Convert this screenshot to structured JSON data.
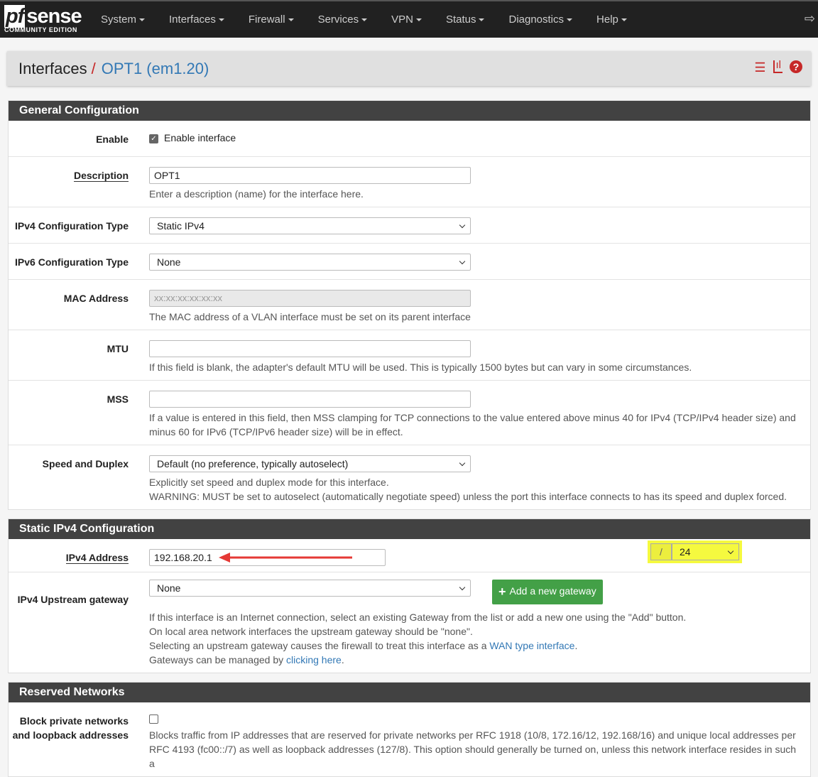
{
  "nav": {
    "logo": "sense",
    "logo_pf": "pf",
    "logo_sub": "COMMUNITY EDITION",
    "items": [
      "System",
      "Interfaces",
      "Firewall",
      "Services",
      "VPN",
      "Status",
      "Diagnostics",
      "Help"
    ]
  },
  "breadcrumb": {
    "parent": "Interfaces",
    "sep": "/",
    "current": "OPT1 (em1.20)"
  },
  "general": {
    "title": "General Configuration",
    "enable_label": "Enable",
    "enable_text": "Enable interface",
    "desc_label": "Description",
    "desc_value": "OPT1",
    "desc_help": "Enter a description (name) for the interface here.",
    "ipv4_label": "IPv4 Configuration Type",
    "ipv4_value": "Static IPv4",
    "ipv6_label": "IPv6 Configuration Type",
    "ipv6_value": "None",
    "mac_label": "MAC Address",
    "mac_placeholder": "xx:xx:xx:xx:xx:xx",
    "mac_help": "The MAC address of a VLAN interface must be set on its parent interface",
    "mtu_label": "MTU",
    "mtu_help": "If this field is blank, the adapter's default MTU will be used. This is typically 1500 bytes but can vary in some circumstances.",
    "mss_label": "MSS",
    "mss_help": "If a value is entered in this field, then MSS clamping for TCP connections to the value entered above minus 40 for IPv4 (TCP/IPv4 header size) and minus 60 for IPv6 (TCP/IPv6 header size) will be in effect.",
    "speed_label": "Speed and Duplex",
    "speed_value": "Default (no preference, typically autoselect)",
    "speed_help1": "Explicitly set speed and duplex mode for this interface.",
    "speed_help2": "WARNING: MUST be set to autoselect (automatically negotiate speed) unless the port this interface connects to has its speed and duplex forced."
  },
  "static": {
    "title": "Static IPv4 Configuration",
    "addr_label": "IPv4 Address",
    "addr_value": "192.168.20.1",
    "mask_sep": "/",
    "mask_value": "24",
    "gw_label": "IPv4 Upstream gateway",
    "gw_value": "None",
    "add_gw": "Add a new gateway",
    "help1": "If this interface is an Internet connection, select an existing Gateway from the list or add a new one using the \"Add\" button.",
    "help2": "On local area network interfaces the upstream gateway should be \"none\".",
    "help3a": "Selecting an upstream gateway causes the firewall to treat this interface as a ",
    "help3b": "WAN type interface",
    "help4a": "Gateways can be managed by ",
    "help4b": "clicking here"
  },
  "reserved": {
    "title": "Reserved Networks",
    "block_label": "Block private networks and loopback addresses",
    "block_help": "Blocks traffic from IP addresses that are reserved for private networks per RFC 1918 (10/8, 172.16/12, 192.168/16) and unique local addresses per RFC 4193 (fc00::/7) as well as loopback addresses (127/8). This option should generally be turned on, unless this network interface resides in such a"
  }
}
